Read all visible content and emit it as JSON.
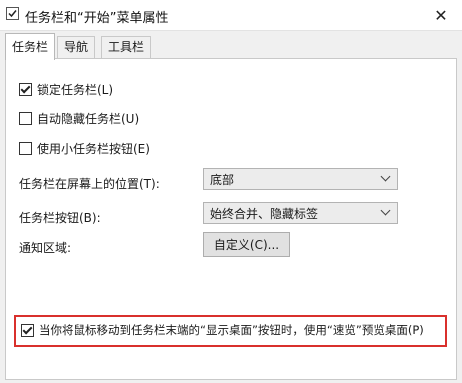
{
  "window": {
    "title": "任务栏和“开始”菜单属性",
    "close_symbol": "✕"
  },
  "tabs": [
    {
      "label": "任务栏",
      "active": true
    },
    {
      "label": "导航",
      "active": false
    },
    {
      "label": "工具栏",
      "active": false
    }
  ],
  "options": {
    "lock_taskbar": {
      "label": "锁定任务栏(L)",
      "checked": true
    },
    "auto_hide": {
      "label": "自动隐藏任务栏(U)",
      "checked": false
    },
    "small_buttons": {
      "label": "使用小任务栏按钮(E)",
      "checked": false
    },
    "peek": {
      "label": "当你将鼠标移动到任务栏末端的“显示桌面”按钮时，使用“速览”预览桌面(P)",
      "checked": true
    }
  },
  "settings": {
    "location": {
      "label": "任务栏在屏幕上的位置(T):",
      "value": "底部"
    },
    "buttons": {
      "label": "任务栏按钮(B):",
      "value": "始终合并、隐藏标签"
    },
    "notification": {
      "label": "通知区域:",
      "button": "自定义(C)..."
    }
  },
  "colors": {
    "highlight_border": "#d9302c"
  }
}
